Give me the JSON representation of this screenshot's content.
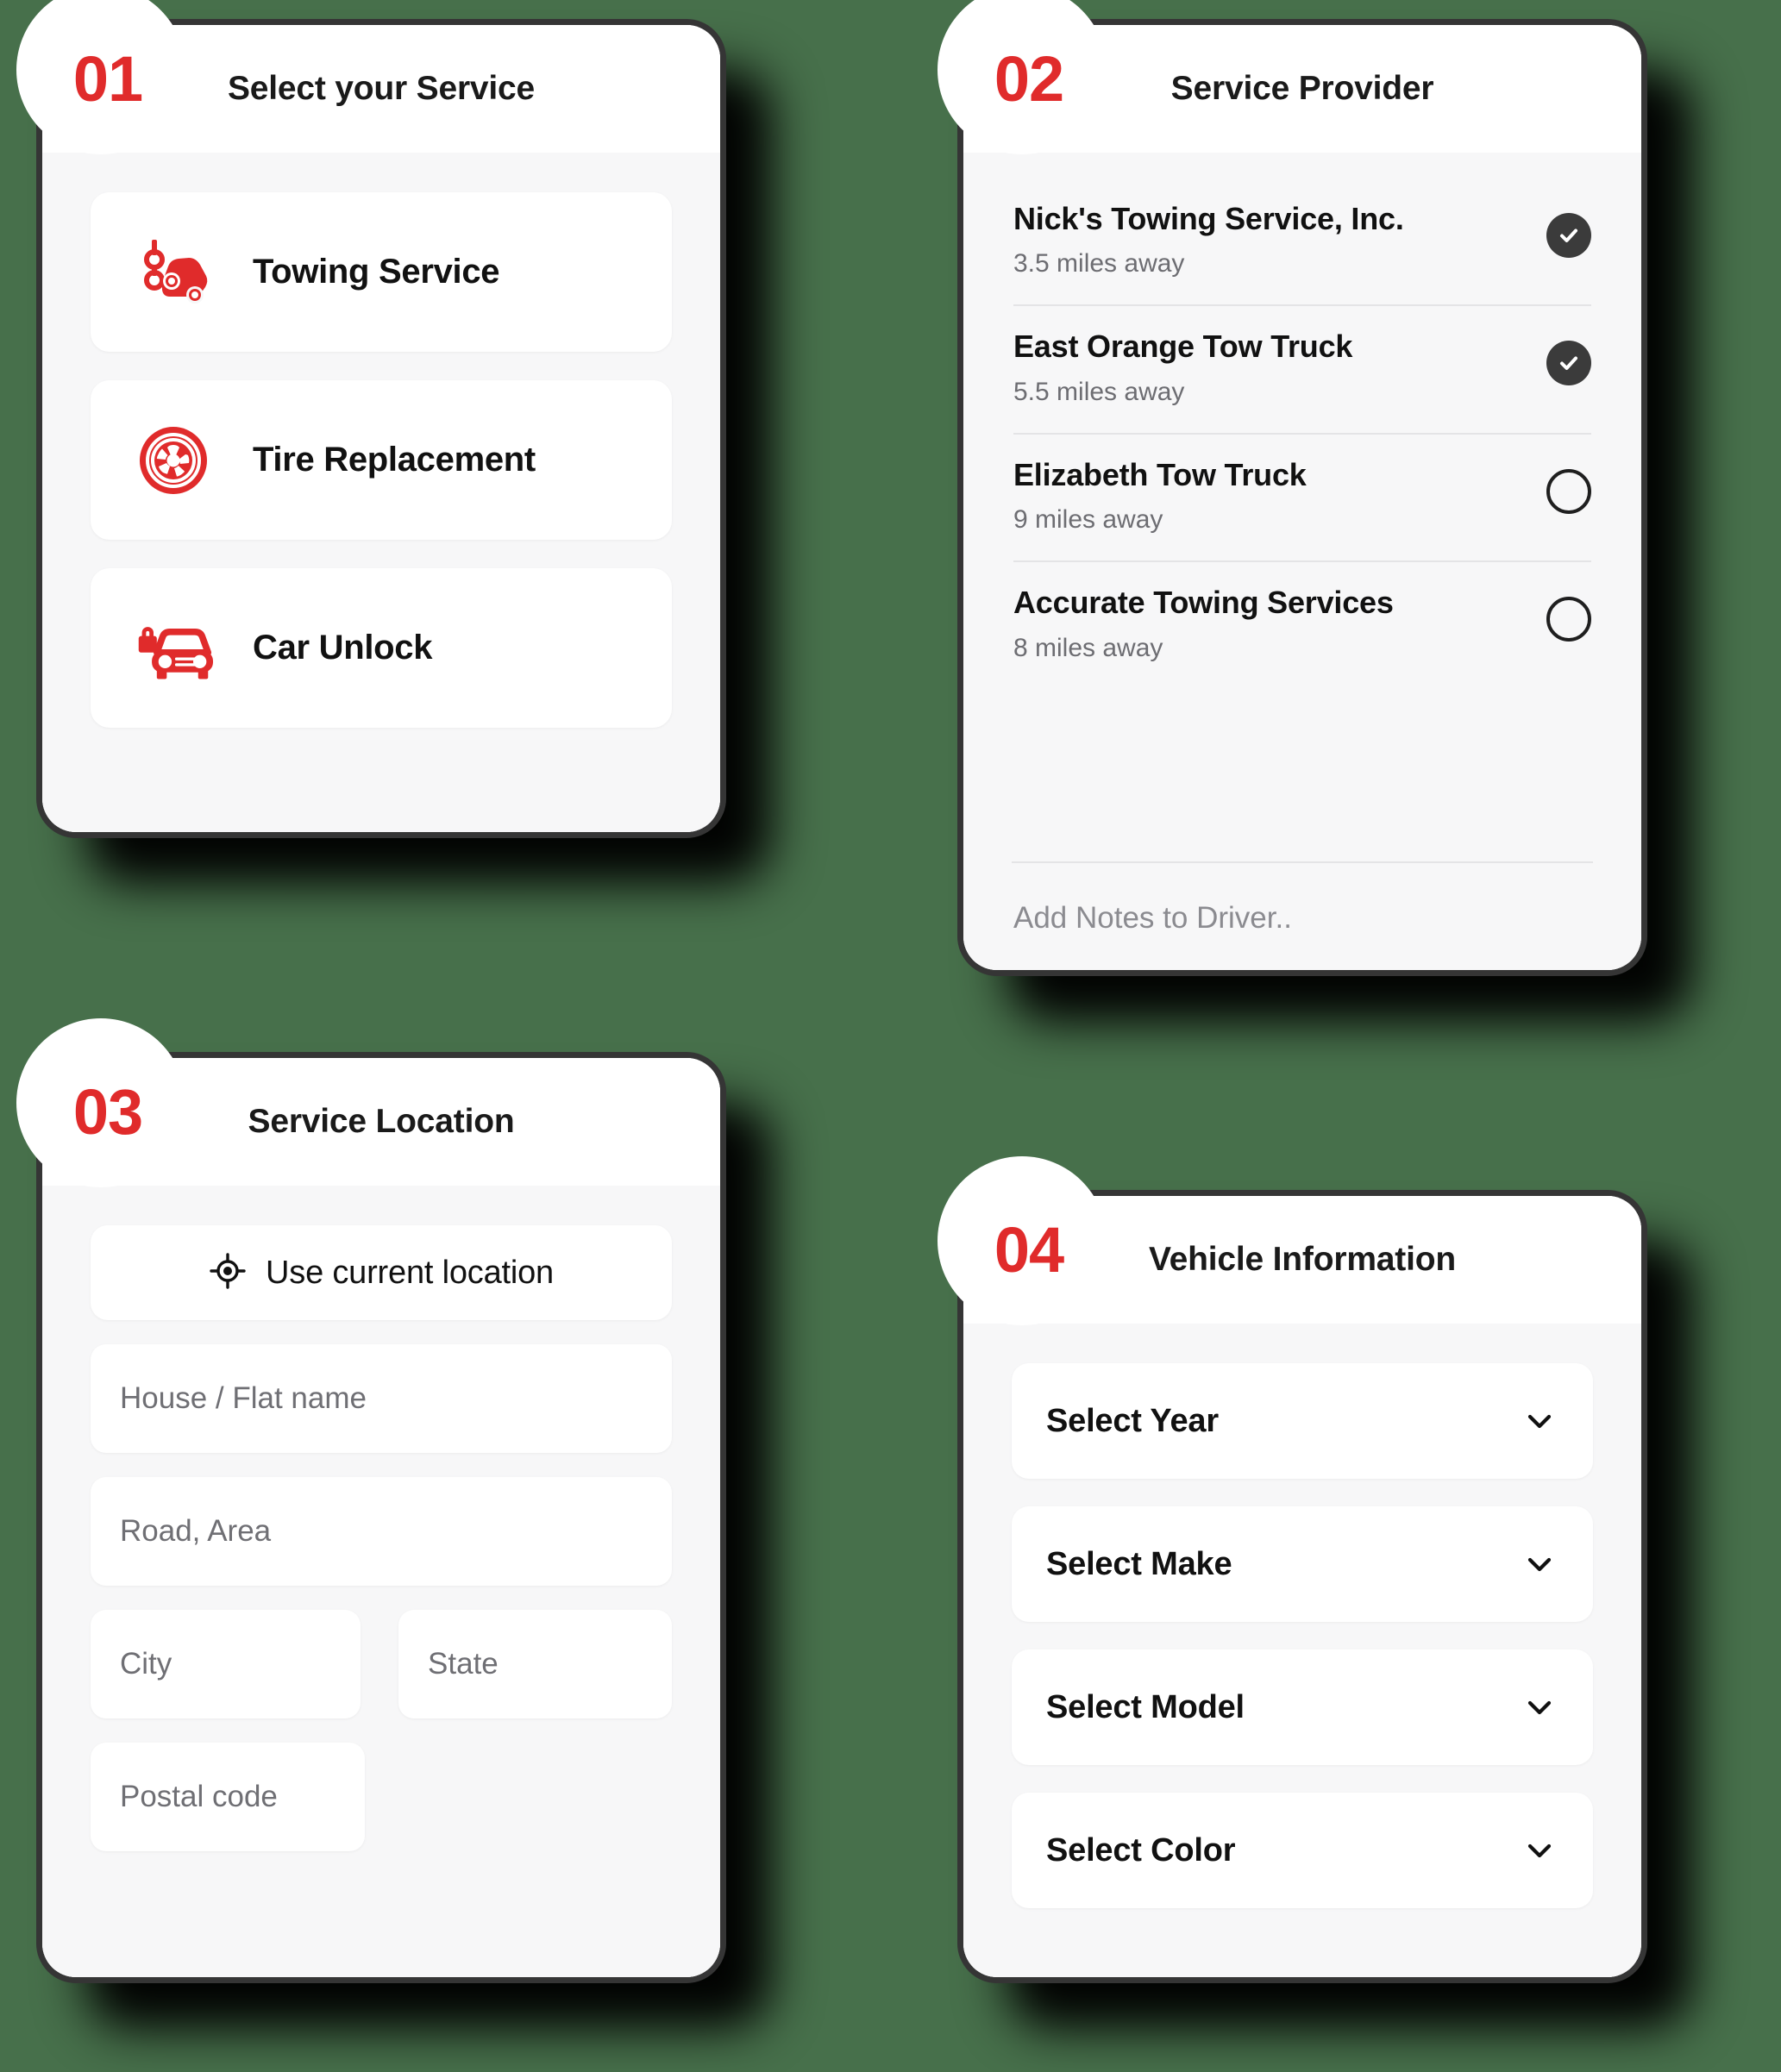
{
  "theme": {
    "background": "#47704B",
    "accent_red": "#E02B2B",
    "card_body": "#F7F7F8",
    "card_header": "#FFFFFF",
    "card_border": "#353535",
    "check_fill": "#3B3B3B",
    "muted_text": "#6D6D72"
  },
  "cards": {
    "service": {
      "step": "01",
      "title": "Select your Service",
      "items": [
        {
          "label": "Towing Service",
          "icon": "tow-truck-icon"
        },
        {
          "label": "Tire Replacement",
          "icon": "tire-wheel-icon"
        },
        {
          "label": "Car Unlock",
          "icon": "car-lock-icon"
        }
      ]
    },
    "provider": {
      "step": "02",
      "title": "Service Provider",
      "items": [
        {
          "name": "Nick's Towing Service, Inc.",
          "distance": "3.5 miles away",
          "selected": true
        },
        {
          "name": "East Orange Tow Truck",
          "distance": "5.5 miles away",
          "selected": true
        },
        {
          "name": "Elizabeth Tow Truck",
          "distance": "9 miles away",
          "selected": false
        },
        {
          "name": "Accurate Towing Services",
          "distance": "8 miles away",
          "selected": false
        }
      ],
      "notes_placeholder": "Add Notes to Driver.."
    },
    "location": {
      "step": "03",
      "title": "Service Location",
      "current_location_label": "Use current location",
      "current_location_icon": "gps-crosshair-icon",
      "fields": [
        {
          "placeholder": "House / Flat name",
          "value": ""
        },
        {
          "placeholder": "Road, Area",
          "value": ""
        },
        {
          "placeholder": "City",
          "value": ""
        },
        {
          "placeholder": "State",
          "value": ""
        },
        {
          "placeholder": "Postal code",
          "value": ""
        }
      ]
    },
    "vehicle": {
      "step": "04",
      "title": "Vehicle Information",
      "selects": [
        {
          "label": "Select Year",
          "icon": "chevron-down-icon"
        },
        {
          "label": "Select Make",
          "icon": "chevron-down-icon"
        },
        {
          "label": "Select Model",
          "icon": "chevron-down-icon"
        },
        {
          "label": "Select Color",
          "icon": "chevron-down-icon"
        }
      ]
    }
  }
}
